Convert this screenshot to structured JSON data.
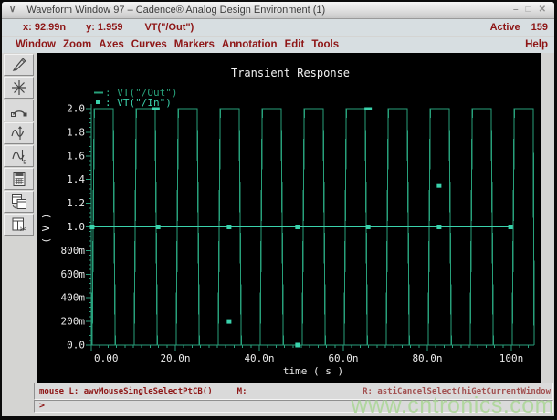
{
  "window": {
    "title": "Waveform Window 97 – Cadence® Analog Design Environment (1)",
    "menu_glyph": "∨",
    "controls": {
      "minimize": "–",
      "maximize": "□",
      "close": "✕"
    }
  },
  "infobar": {
    "x_readout": "x: 92.99n",
    "y_readout": "y: 1.959",
    "trace_readout": "VT(\"/Out\")",
    "active_label": "Active",
    "active_count": "159"
  },
  "menubar": {
    "items": [
      "Window",
      "Zoom",
      "Axes",
      "Curves",
      "Markers",
      "Annotation",
      "Edit",
      "Tools"
    ],
    "help": "Help"
  },
  "toolbar": {
    "icons": [
      "pen-icon",
      "zoom-burst-icon",
      "strip-tool-icon",
      "marker-tool-icon",
      "waveform-b-icon",
      "calculator-icon",
      "duplicate-window-icon",
      "cut-region-icon"
    ]
  },
  "statusbar": {
    "mouse_left_binding": "mouse L: awvMouseSingleSelectPtCB()",
    "mouse_middle_binding": "M:",
    "mouse_right_binding": "R: astiCancelSelect(hiGetCurrentWindow",
    "prompt": ">"
  },
  "watermark": "www.cntronics.com",
  "chart_data": {
    "type": "line",
    "title": "Transient Response",
    "xlabel": "time ( s )",
    "ylabel": "( V )",
    "xlim_ns": [
      0,
      100
    ],
    "ylim": [
      0,
      2.0
    ],
    "x_ticks": [
      "0.00",
      "20.0n",
      "40.0n",
      "60.0n",
      "80.0n",
      "100n"
    ],
    "y_ticks": [
      "0.0",
      "200m",
      "400m",
      "600m",
      "800m",
      "1.0",
      "1.2",
      "1.4",
      "1.6",
      "1.8",
      "2.0"
    ],
    "plot_bg": "#000000",
    "axis_color": "#2aa17e",
    "text_color": "#eaeaea",
    "series": [
      {
        "name": "VT(\"/Out\")",
        "color": "#27a07a",
        "type": "pulse",
        "period_ns": 10,
        "rise_ns": 0.5,
        "high_ns": 4.5,
        "high_v": 2.0,
        "low_v": 0.0,
        "t_start_ns": 0.2,
        "t_end_ns": 105.4
      },
      {
        "name": "VT(\"/In\")",
        "color": "#3ad2ac",
        "type": "constant",
        "value_v": 1.0,
        "marker_t_ns": [
          0.2,
          15.9,
          32.8,
          49.1,
          65.9,
          82.8,
          99.8
        ],
        "stray_markers": [
          {
            "t_ns": 15.4,
            "v": 2.0,
            "shape": "dash"
          },
          {
            "t_ns": 65.9,
            "v": 2.0,
            "shape": "dash"
          },
          {
            "t_ns": 82.8,
            "v": 1.35,
            "shape": "square"
          },
          {
            "t_ns": 32.8,
            "v": 0.2,
            "shape": "square"
          },
          {
            "t_ns": 49.1,
            "v": 0.0,
            "shape": "square"
          }
        ]
      }
    ],
    "legend_position": "top-left",
    "grid": false
  }
}
